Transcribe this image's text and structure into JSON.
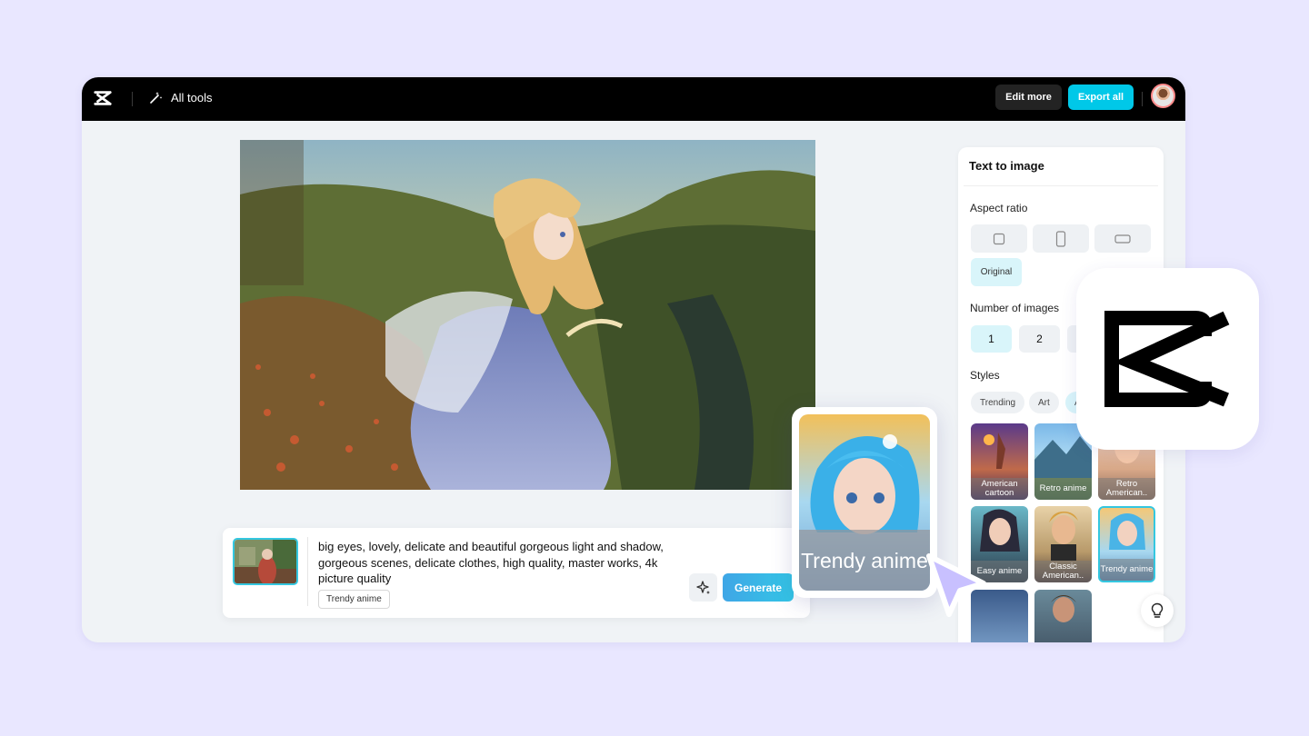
{
  "topbar": {
    "all_tools_label": "All tools",
    "edit_more_label": "Edit more",
    "export_all_label": "Export all"
  },
  "prompt": {
    "text": "big eyes, lovely, delicate and beautiful   gorgeous light and shadow, gorgeous scenes, delicate clothes, high quality, master works, 4k picture quality",
    "style_tag": "Trendy anime",
    "generate_label": "Generate"
  },
  "panel": {
    "title": "Text to image",
    "aspect_ratio_label": "Aspect ratio",
    "original_label": "Original",
    "number_of_images_label": "Number of images",
    "number_options": [
      "1",
      "2"
    ],
    "styles_label": "Styles",
    "style_tabs": [
      "Trending",
      "Art",
      "A"
    ],
    "style_cards": [
      {
        "label": "American cartoon"
      },
      {
        "label": "Retro anime"
      },
      {
        "label": "Retro American.."
      },
      {
        "label": "Easy anime"
      },
      {
        "label": "Classic American.."
      },
      {
        "label": "Trendy anime",
        "selected": true
      }
    ]
  },
  "floating_card": {
    "label": "Trendy anime"
  },
  "colors": {
    "accent": "#00c8e8",
    "background": "#e9e7ff",
    "topbar": "#000000"
  }
}
